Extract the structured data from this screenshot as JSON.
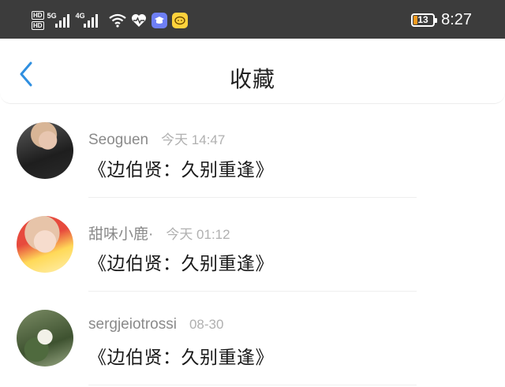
{
  "status_bar": {
    "hd_top": "HD",
    "hd_bottom": "HD",
    "net1": "5G",
    "net2": "4G",
    "battery": "13",
    "time": "8:27",
    "icons": [
      "wifi-icon",
      "health-heart-icon",
      "app-hat-icon",
      "app-chat-icon"
    ]
  },
  "header": {
    "back_icon": "chevron-left-icon",
    "title": "收藏"
  },
  "items": [
    {
      "user": "Seoguen",
      "time": "今天 14:47",
      "title": "《边伯贤：久别重逢》"
    },
    {
      "user": "甜味小鹿·",
      "time": "今天 01:12",
      "title": "《边伯贤：久别重逢》"
    },
    {
      "user": "sergjeiotrossi",
      "time": "08-30",
      "title": "《边伯贤：久别重逢》"
    }
  ],
  "colors": {
    "status_bar_bg": "#3c3c3c",
    "accent_blue": "#2f8fe0",
    "battery_orange": "#f39a1e"
  }
}
